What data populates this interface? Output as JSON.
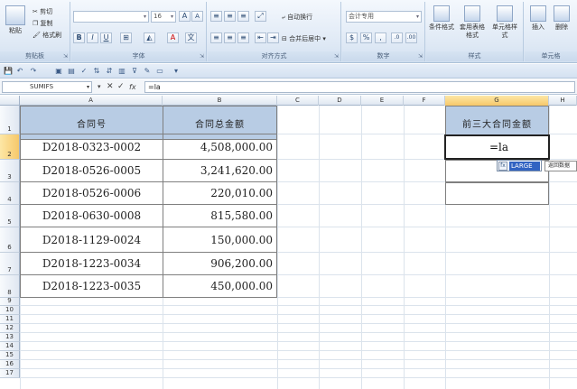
{
  "ribbon": {
    "clipboard": {
      "paste": "粘贴",
      "cut": "剪切",
      "copy": "复制",
      "format_painter": "格式刷",
      "group": "剪贴板"
    },
    "font": {
      "name": "",
      "size": "16",
      "group": "字体",
      "bold": "B",
      "italic": "I",
      "underline": "U",
      "grow": "A",
      "shrink": "A"
    },
    "alignment": {
      "wrap": "自动换行",
      "merge": "合并后居中",
      "group": "对齐方式"
    },
    "number": {
      "format": "会计专用",
      "group": "数字",
      "currency": "%"
    },
    "styles": {
      "conditional": "条件格式",
      "table": "套用表格格式",
      "cell": "单元格样式",
      "group": "样式"
    },
    "cells": {
      "insert": "插入",
      "delete": "删除",
      "group": "单元格"
    }
  },
  "formula_bar": {
    "name_box": "SUMIFS",
    "cancel": "✕",
    "enter": "✓",
    "fx": "fx",
    "formula": "=la"
  },
  "columns": [
    "A",
    "B",
    "C",
    "D",
    "E",
    "F",
    "G",
    "H"
  ],
  "rows": [
    "1",
    "2",
    "3",
    "4",
    "5",
    "6",
    "7",
    "8",
    "9",
    "10",
    "11",
    "12",
    "13",
    "14",
    "15",
    "16",
    "17"
  ],
  "table": {
    "headers": [
      "合同号",
      "合同总金额"
    ],
    "rows": [
      [
        "D2018-0323-0002",
        "4,508,000.00"
      ],
      [
        "D2018-0526-0005",
        "3,241,620.00"
      ],
      [
        "D2018-0526-0006",
        "220,010.00"
      ],
      [
        "D2018-0630-0008",
        "815,580.00"
      ],
      [
        "D2018-1129-0024",
        "150,000.00"
      ],
      [
        "D2018-1223-0034",
        "906,200.00"
      ],
      [
        "D2018-1223-0035",
        "450,000.00"
      ]
    ]
  },
  "side_table": {
    "header": "前三大合同金额",
    "editing_value": "=la"
  },
  "autocomplete": {
    "icon": "fx",
    "function": "LARGE",
    "tooltip": "返回数据"
  }
}
